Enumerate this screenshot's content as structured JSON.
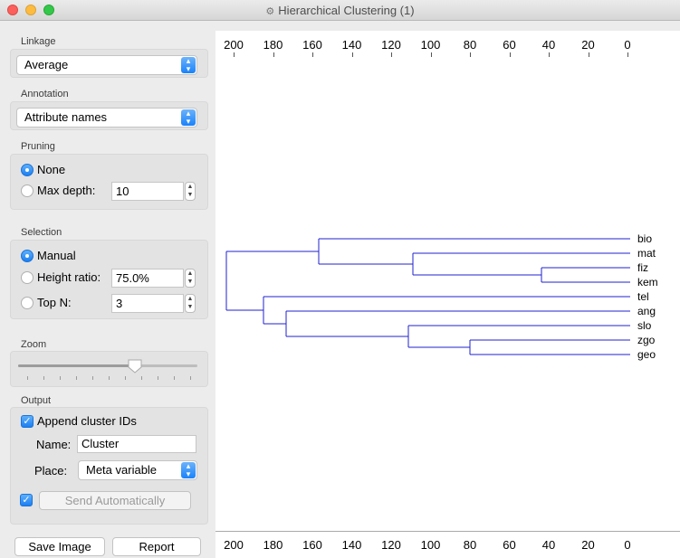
{
  "window": {
    "title": "Hierarchical Clustering (1)"
  },
  "linkage": {
    "label": "Linkage",
    "value": "Average"
  },
  "annotation": {
    "label": "Annotation",
    "value": "Attribute names"
  },
  "pruning": {
    "label": "Pruning",
    "none_label": "None",
    "max_depth_label": "Max depth:",
    "max_depth_value": "10"
  },
  "selection": {
    "label": "Selection",
    "manual_label": "Manual",
    "height_ratio_label": "Height ratio:",
    "height_ratio_value": "75.0%",
    "top_n_label": "Top N:",
    "top_n_value": "3"
  },
  "zoom": {
    "label": "Zoom",
    "level": 0.65
  },
  "output": {
    "label": "Output",
    "append_label": "Append cluster IDs",
    "name_label": "Name:",
    "name_value": "Cluster",
    "place_label": "Place:",
    "place_value": "Meta variable",
    "send_label": "Send Automatically"
  },
  "buttons": {
    "save_image": "Save Image",
    "report": "Report"
  },
  "axis": {
    "ticks": [
      "200",
      "180",
      "160",
      "140",
      "120",
      "100",
      "80",
      "60",
      "40",
      "20",
      "0"
    ]
  },
  "leaves": [
    "bio",
    "mat",
    "fiz",
    "kem",
    "tel",
    "ang",
    "slo",
    "zgo",
    "geo"
  ],
  "dendrogram_color": "#2020d0",
  "accent_color": "#1c7ff2"
}
